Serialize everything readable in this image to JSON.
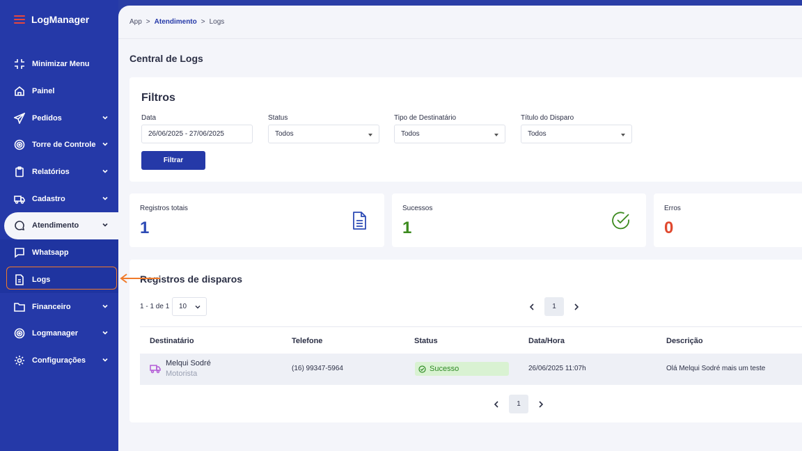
{
  "app": {
    "name": "LogManager"
  },
  "sidebar": {
    "items": [
      {
        "label": "Minimizar Menu",
        "icon": "minimize-icon"
      },
      {
        "label": "Painel",
        "icon": "home-icon"
      },
      {
        "label": "Pedidos",
        "icon": "send-icon"
      },
      {
        "label": "Torre de Controle",
        "icon": "target-icon"
      },
      {
        "label": "Relatórios",
        "icon": "clipboard-icon"
      },
      {
        "label": "Cadastro",
        "icon": "truck-icon"
      },
      {
        "label": "Atendimento",
        "icon": "chat-icon"
      },
      {
        "label": "Whatsapp",
        "icon": "message-square-icon"
      },
      {
        "label": "Logs",
        "icon": "file-icon"
      },
      {
        "label": "Financeiro",
        "icon": "folder-icon"
      },
      {
        "label": "Logmanager",
        "icon": "target-icon"
      },
      {
        "label": "Configurações",
        "icon": "gear-icon"
      }
    ]
  },
  "breadcrumb": {
    "items": [
      "App",
      "Atendimento",
      "Logs"
    ]
  },
  "page": {
    "title": "Central de Logs"
  },
  "filters": {
    "title": "Filtros",
    "date": {
      "label": "Data",
      "value": "26/06/2025 - 27/06/2025"
    },
    "status": {
      "label": "Status",
      "value": "Todos"
    },
    "recipient_type": {
      "label": "Tipo de Destinatário",
      "value": "Todos"
    },
    "dispatch_title": {
      "label": "Título do Disparo",
      "value": "Todos"
    },
    "button": "Filtrar"
  },
  "stats": [
    {
      "label": "Registros totais",
      "value": "1",
      "color": "#2d4bb5"
    },
    {
      "label": "Sucessos",
      "value": "1",
      "color": "#3c8a1e"
    },
    {
      "label": "Erros",
      "value": "0",
      "color": "#e0492f"
    }
  ],
  "records": {
    "title": "Registros de disparos",
    "range": "1 - 1 de 1",
    "per_page": "10",
    "page": "1",
    "columns": [
      "Destinatário",
      "Telefone",
      "Status",
      "Data/Hora",
      "Descrição"
    ],
    "rows": [
      {
        "name": "Melqui Sodré",
        "role": "Motorista",
        "phone": "(16) 99347-5964",
        "status": "Sucesso",
        "datetime": "26/06/2025 11:07h",
        "description": "Olá Melqui Sodré mais um teste"
      }
    ]
  }
}
